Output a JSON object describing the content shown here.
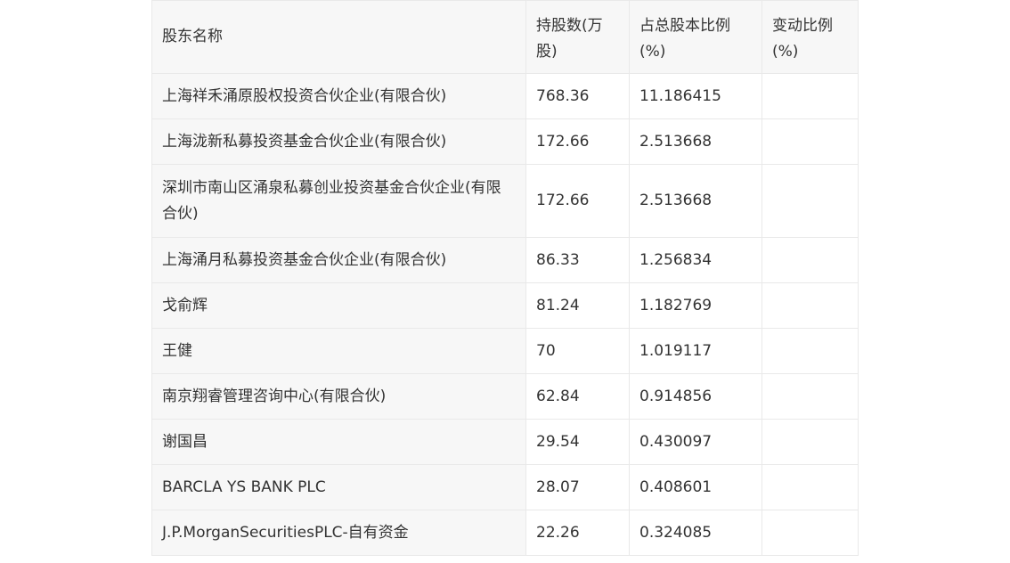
{
  "table": {
    "headers": [
      "股东名称",
      "持股数(万股)",
      "占总股本比例(%)",
      "变动比例(%)"
    ],
    "rows": [
      {
        "name": "上海祥禾涌原股权投资合伙企业(有限合伙)",
        "shares": "768.36",
        "ratio": "11.186415",
        "change": ""
      },
      {
        "name": "上海泷新私募投资基金合伙企业(有限合伙)",
        "shares": "172.66",
        "ratio": "2.513668",
        "change": ""
      },
      {
        "name": "深圳市南山区涌泉私募创业投资基金合伙企业(有限合伙)",
        "shares": "172.66",
        "ratio": "2.513668",
        "change": ""
      },
      {
        "name": "上海涌月私募投资基金合伙企业(有限合伙)",
        "shares": "86.33",
        "ratio": "1.256834",
        "change": ""
      },
      {
        "name": "戈俞辉",
        "shares": "81.24",
        "ratio": "1.182769",
        "change": ""
      },
      {
        "name": "王健",
        "shares": "70",
        "ratio": "1.019117",
        "change": ""
      },
      {
        "name": "南京翔睿管理咨询中心(有限合伙)",
        "shares": "62.84",
        "ratio": "0.914856",
        "change": ""
      },
      {
        "name": "谢国昌",
        "shares": "29.54",
        "ratio": "0.430097",
        "change": ""
      },
      {
        "name": "BARCLA YS BANK PLC",
        "shares": "28.07",
        "ratio": "0.408601",
        "change": ""
      },
      {
        "name": "J.P.MorganSecuritiesPLC-自有资金",
        "shares": "22.26",
        "ratio": "0.324085",
        "change": ""
      }
    ]
  }
}
